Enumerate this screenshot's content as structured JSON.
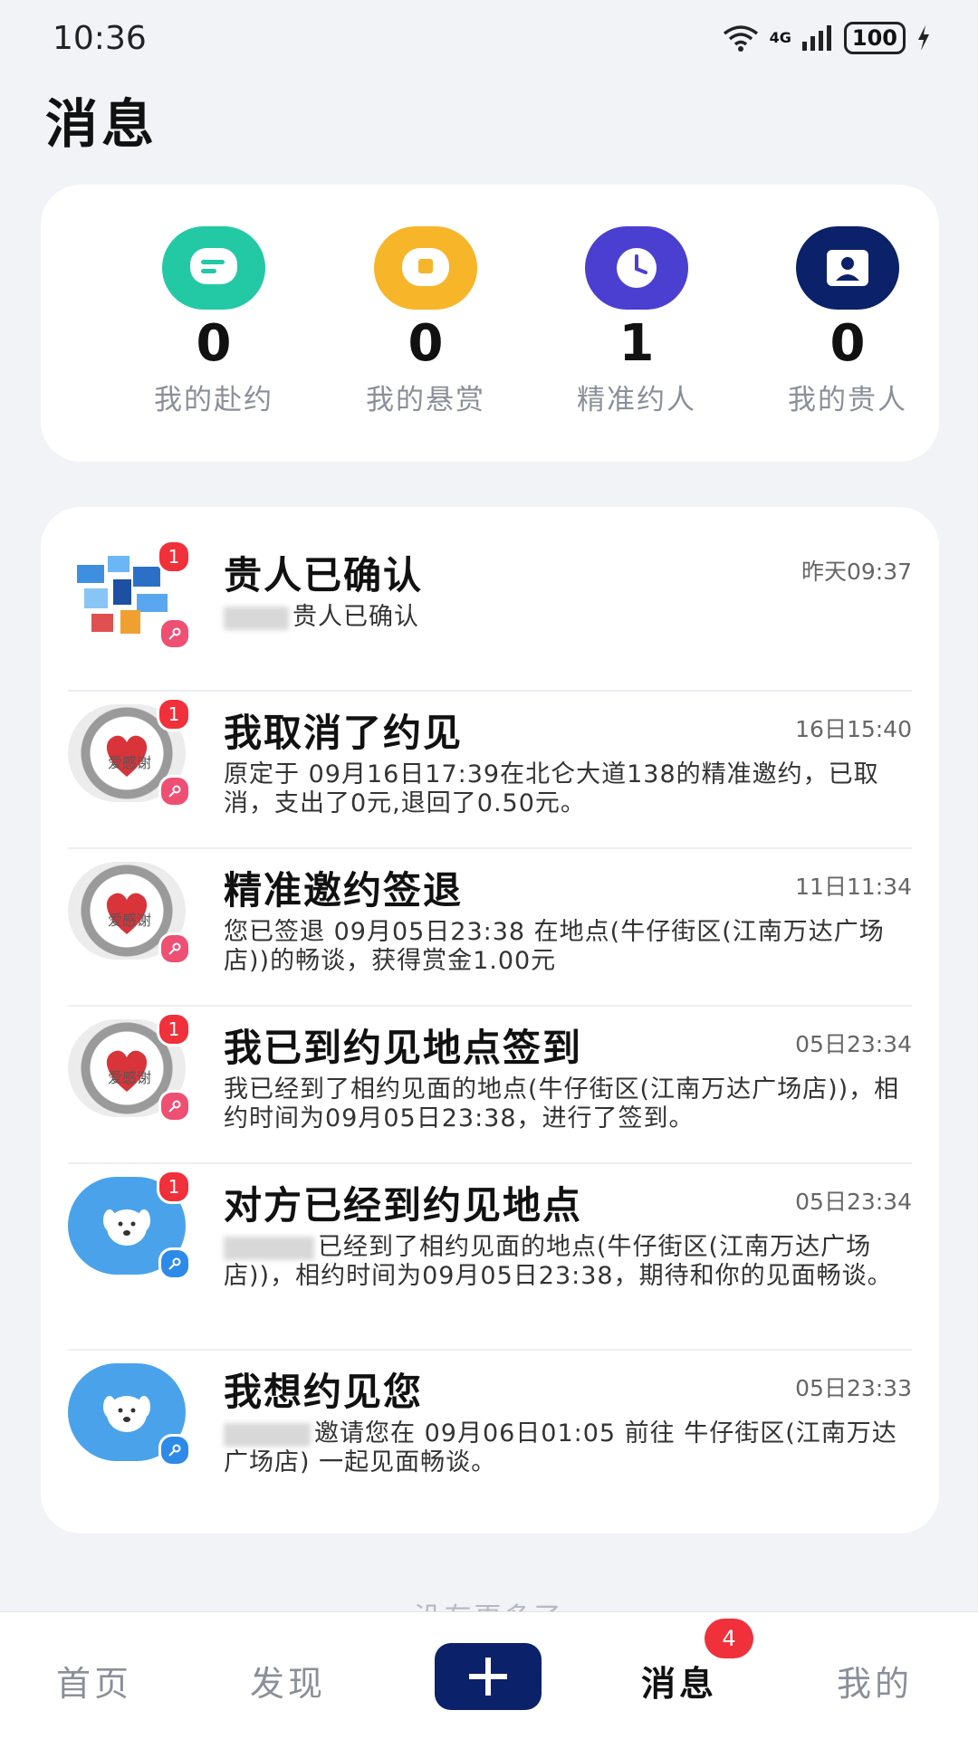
{
  "status_bar": {
    "time": "10:36",
    "network": "4G",
    "battery": "100"
  },
  "page": {
    "title": "消息"
  },
  "stats": [
    {
      "count": "0",
      "label": "我的赴约",
      "icon": "chat-icon",
      "color": "#22c9a4"
    },
    {
      "count": "0",
      "label": "我的悬赏",
      "icon": "coin-icon",
      "color": "#f7b52a"
    },
    {
      "count": "1",
      "label": "精准约人",
      "icon": "clock-icon",
      "color": "#4b3fd1"
    },
    {
      "count": "0",
      "label": "我的贵人",
      "icon": "contact-icon",
      "color": "#0b2169"
    }
  ],
  "messages": [
    {
      "title": "贵人已确认",
      "time": "昨天09:37",
      "body": "贵人已确认",
      "unread": "1",
      "avatar": "collage"
    },
    {
      "title": "我取消了约见",
      "time": "16日15:40",
      "body": "原定于 09月16日17:39在北仑大道138的精准邀约，已取消，支出了0元,退回了0.50元。",
      "unread": "1",
      "avatar": "logo"
    },
    {
      "title": "精准邀约签退",
      "time": "11日11:34",
      "body": "您已签退 09月05日23:38 在地点(牛仔街区(江南万达广场店))的畅谈，获得赏金1.00元",
      "unread": "",
      "avatar": "logo"
    },
    {
      "title": "我已到约见地点签到",
      "time": "05日23:34",
      "body": "我已经到了相约见面的地点(牛仔街区(江南万达广场店))，相约时间为09月05日23:38，进行了签到。",
      "unread": "1",
      "avatar": "logo"
    },
    {
      "title": "对方已经到约见地点",
      "time": "05日23:34",
      "body": "已经到了相约见面的地点(牛仔街区(江南万达广场店))，相约时间为09月05日23:38，期待和你的见面畅谈。",
      "unread": "1",
      "avatar": "dog"
    },
    {
      "title": "我想约见您",
      "time": "05日23:33",
      "body": "邀请您在 09月06日01:05 前往 牛仔街区(江南万达广场店) 一起见面畅谈。",
      "unread": "",
      "avatar": "dog"
    }
  ],
  "footer_hint": "没有更多了",
  "tabbar": {
    "home": "首页",
    "discover": "发现",
    "messages": "消息",
    "messages_badge": "4",
    "mine": "我的"
  }
}
